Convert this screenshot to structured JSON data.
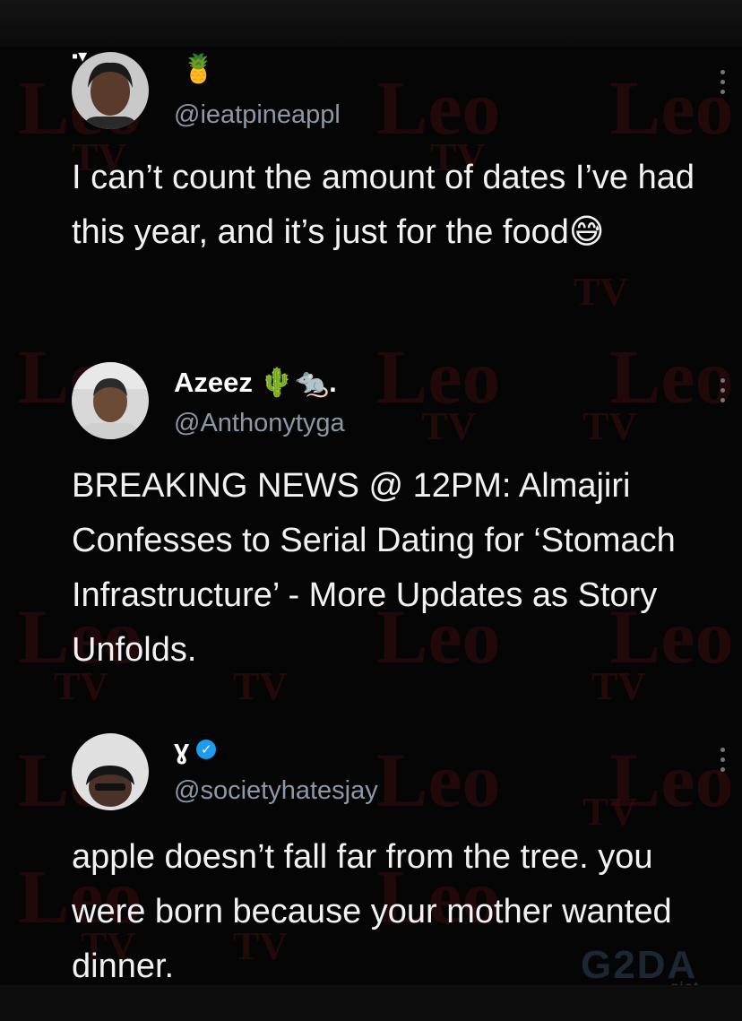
{
  "top_mark": "▪▾",
  "watermark": {
    "text": "Leo",
    "sub": "TV"
  },
  "tweets": [
    {
      "display_name": "",
      "name_emoji": "🍍",
      "handle": "@ieatpineappl",
      "body": "I can’t count the amount of dates I’ve had this year, and it’s just for the food😅",
      "avatar_colors": {
        "bg": "#c9c9c9",
        "skin": "#5a3a2a",
        "hair": "#1a1a1a"
      }
    },
    {
      "display_name": "Azeez",
      "name_emoji": "🌵🐀.",
      "handle": "@Anthonytyga",
      "body": "BREAKING NEWS @ 12PM: Almajiri Confesses to Serial Dating for ‘Stomach Infrastructure’ - More Updates as Story Unfolds.",
      "avatar_colors": {
        "bg": "#d8d8d8",
        "skin": "#6b4a36",
        "hair": "#2b2b2b"
      }
    },
    {
      "display_name": "ɣ",
      "name_emoji": "",
      "verified": true,
      "verified_icon": "✓",
      "handle": "@societyhatesjay",
      "body": "apple doesn’t fall far from the tree. you were born because your mother wanted dinner.",
      "avatar_colors": {
        "bg": "#e0e0e0",
        "skin": "#4a3228",
        "hair": "#151515"
      }
    }
  ],
  "logo": {
    "text": "G2DA",
    "sub": "gist"
  },
  "colors": {
    "background": "#050505",
    "handle": "#8b98a5",
    "verified": "#1d9bf0",
    "watermark": "#3a0d0d"
  }
}
